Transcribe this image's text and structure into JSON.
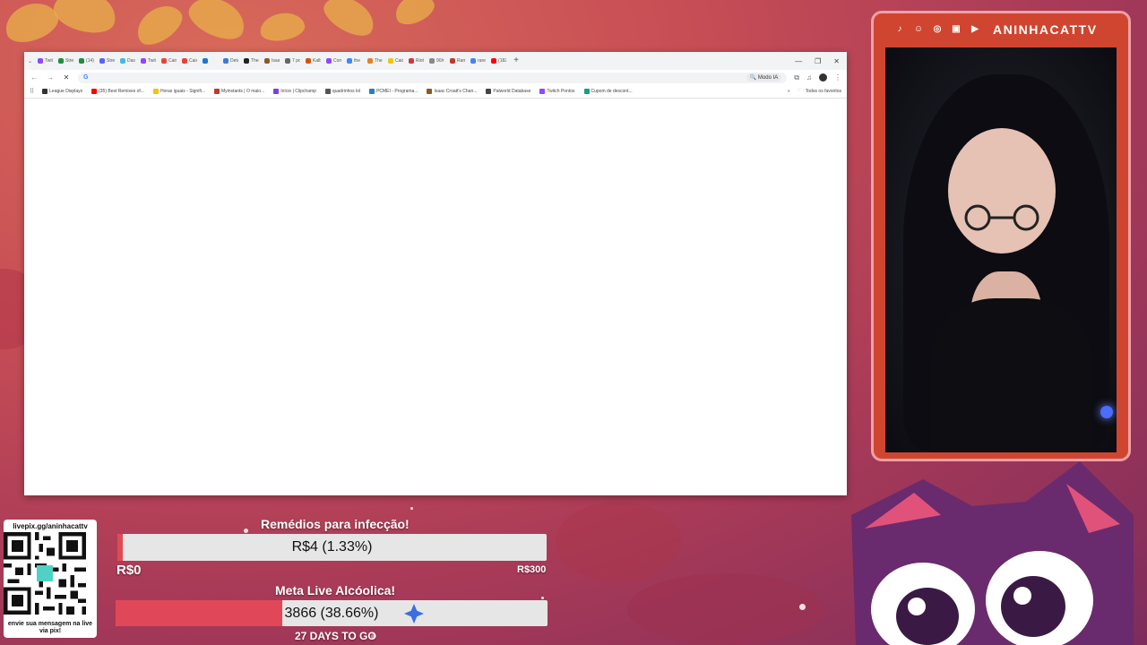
{
  "overlay": {
    "channel_handle": "ANINHACATTV",
    "social_icons": [
      "tiktok-icon",
      "discord-icon",
      "instagram-icon",
      "twitch-icon",
      "youtube-icon"
    ]
  },
  "browser": {
    "tabs": [
      {
        "label": "Twit",
        "color": "#9146ff"
      },
      {
        "label": "Strea",
        "color": "#1e8e3e"
      },
      {
        "label": "(14)",
        "color": "#1e8e3e"
      },
      {
        "label": "Stre",
        "color": "#5865f2"
      },
      {
        "label": "Dash",
        "color": "#44bbdd"
      },
      {
        "label": "Twit",
        "color": "#9146ff"
      },
      {
        "label": "Cain",
        "color": "#ea4335"
      },
      {
        "label": "Caix",
        "color": "#ea4335"
      },
      {
        "label": "",
        "color": "#1976d2"
      },
      {
        "label": "Deta",
        "color": "#3a7bd5"
      },
      {
        "label": "The",
        "color": "#222222"
      },
      {
        "label": "Isaa",
        "color": "#8b5a2b"
      },
      {
        "label": "7 pq",
        "color": "#666666"
      },
      {
        "label": "Kalb",
        "color": "#d35400"
      },
      {
        "label": "Con",
        "color": "#9146ff"
      },
      {
        "label": "the",
        "color": "#4285f4"
      },
      {
        "label": "The",
        "color": "#e67e22"
      },
      {
        "label": "Caiq",
        "color": "#f1c40f"
      },
      {
        "label": "Riot",
        "color": "#d13639"
      },
      {
        "label": "90/r",
        "color": "#888888"
      },
      {
        "label": "Ram",
        "color": "#c0392b"
      },
      {
        "label": "rare",
        "color": "#4285f4"
      },
      {
        "label": "(182",
        "color": "#ff0000"
      }
    ],
    "new_tab_symbol": "+",
    "omnibox": {
      "value": "",
      "placeholder": "",
      "ai_mode_label": "Modo IA",
      "g_label": "G"
    },
    "bookmarks": [
      {
        "label": "League Displays",
        "color": "#333333"
      },
      {
        "label": "(35) Best Remixes of...",
        "color": "#ff0000"
      },
      {
        "label": "Horas iguais - Signifi...",
        "color": "#f1c40f"
      },
      {
        "label": "Myinstants | O maio...",
        "color": "#c0392b"
      },
      {
        "label": "Início | Clipchamp",
        "color": "#7b3fe4"
      },
      {
        "label": "quadrinhos lol",
        "color": "#555555"
      },
      {
        "label": "PCMEI - Programa...",
        "color": "#2980b9"
      },
      {
        "label": "Isaac Croatt's Chan...",
        "color": "#8b5a2b"
      },
      {
        "label": "Palworld Database",
        "color": "#444444"
      },
      {
        "label": "Twitch Pontos",
        "color": "#9146ff"
      },
      {
        "label": "Cupom de descont...",
        "color": "#16a085"
      }
    ],
    "all_bookmarks_label": "Todos os favoritos"
  },
  "goals": [
    {
      "title": "Remédios para infecção!",
      "bar_text": "R$4 (1.33%)",
      "progress": 0.0133,
      "fill_color": "#e04a52",
      "min_label": "R$0",
      "max_label": "R$300"
    },
    {
      "title": "Meta Live Alcóolica!",
      "bar_text": "3866 (38.66%)",
      "progress": 0.3866,
      "fill_color": "#e0485a",
      "footer": "27 DAYS TO GO"
    }
  ],
  "pix": {
    "top": "livepix.gg/aninhacattv",
    "bottom": "envie sua mensagem na live via pix!"
  }
}
